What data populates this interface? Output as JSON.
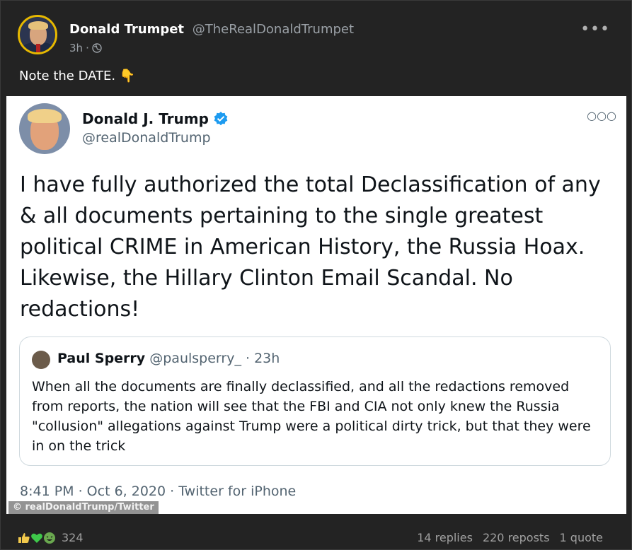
{
  "post": {
    "display_name": "Donald Trumpet",
    "handle": "@TheRealDonaldTrumpet",
    "time": "3h",
    "separator": "·",
    "text": "Note the DATE.",
    "emoji": "👇",
    "more_icon": "more-options-icon",
    "visibility_icon": "globe-icon"
  },
  "embed": {
    "name": "Donald J. Trump",
    "handle": "@realDonaldTrump",
    "verified_color": "#1d9bf0",
    "text_lines": [
      "I have fully authorized the total Declassification of any",
      "& all documents pertaining to the single greatest",
      "political CRIME in American History, the Russia Hoax.",
      "Likewise, the Hillary Clinton Email Scandal. No",
      "redactions!"
    ],
    "quote": {
      "name": "Paul Sperry",
      "handle": "@paulsperry_",
      "time": "· 23h",
      "lines": [
        "When all the documents are finally declassified, and all the redactions removed",
        "from reports, the nation will see that the FBI and CIA not only knew the Russia",
        "\"collusion\" allegations against Trump were a political dirty trick, but that they were",
        "in on the trick"
      ]
    },
    "footer": "8:41 PM · Oct 6, 2020 · Twitter for iPhone",
    "credit": "© realDonaldTrump/Twitter"
  },
  "actions": {
    "reaction_icons": [
      "thumbs-up-icon",
      "green-heart-icon",
      "laughing-face-icon"
    ],
    "reaction_count": "324",
    "replies": "14 replies",
    "reposts": "220 reposts",
    "quotes": "1 quote"
  }
}
